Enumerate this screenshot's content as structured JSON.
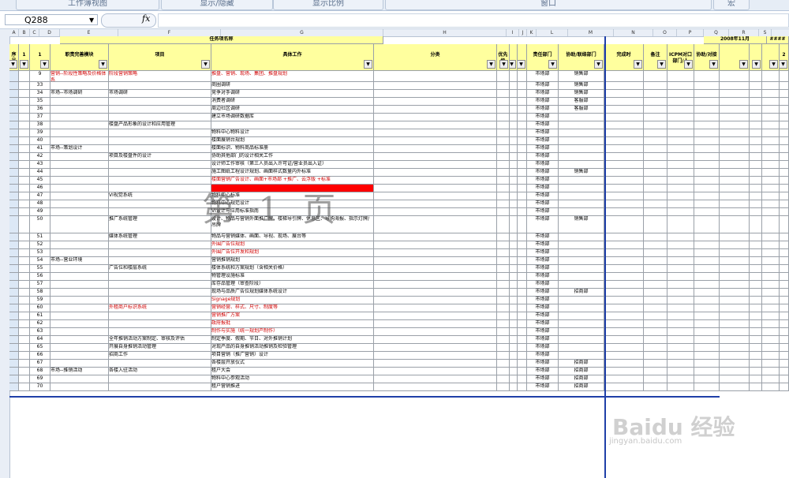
{
  "ribbon": {
    "tabs": [
      "工作簿视图",
      "显示/隐藏",
      "显示比例",
      "窗口",
      "宏"
    ]
  },
  "formula_bar": {
    "name_box": "Q288",
    "fx": "fx",
    "value": ""
  },
  "columns": [
    "A",
    "B",
    "C",
    "D",
    "E",
    "F",
    "G",
    "H",
    "I",
    "J",
    "K",
    "L",
    "M",
    "N",
    "O",
    "P",
    "Q",
    "R",
    "S"
  ],
  "header": {
    "group_title": "任务项名称",
    "date_label": "2008年11月",
    "hash": "####",
    "labels": {
      "a": "序号",
      "responsible": "职责完善模块",
      "item": "项目",
      "work": "具体工作",
      "category": "分类",
      "priority": "优先级",
      "dept": "责任部门",
      "assist": "协助/联络部门",
      "complete": "完成时",
      "note": "备注",
      "icpm": "ICPM对口部门/人",
      "assist2": "协助/对接",
      "c1": "1",
      "c2": "1",
      "c3": "2"
    }
  },
  "rows": [
    {
      "no": "9",
      "module": "营销--阶段性策略及价格体系",
      "item": "阶段营销策略",
      "work": "推盘、营销、现场、集团、推盘规划",
      "dept": "市场部",
      "assist": "销售部",
      "red": true
    },
    {
      "no": "33",
      "module": "",
      "item": "",
      "work": "商圈调研",
      "dept": "市场部",
      "assist": "销售部"
    },
    {
      "no": "34",
      "module": "市场--市场调研",
      "item": "市场调研",
      "work": "竞争对手调研",
      "dept": "市场部",
      "assist": "销售部"
    },
    {
      "no": "35",
      "module": "",
      "item": "",
      "work": "消费者调研",
      "dept": "市场部",
      "assist": "客服部"
    },
    {
      "no": "36",
      "module": "",
      "item": "",
      "work": "周边社区调研",
      "dept": "市场部",
      "assist": "客服部"
    },
    {
      "no": "37",
      "module": "",
      "item": "",
      "work": "建立市场调研数据库",
      "dept": "市场部",
      "assist": ""
    },
    {
      "no": "38",
      "module": "",
      "item": "楼盘产品形象的设计和应用管理",
      "work": "",
      "dept": "市场部",
      "assist": ""
    },
    {
      "no": "39",
      "module": "",
      "item": "",
      "work": "物料中心物料设计",
      "dept": "市场部",
      "assist": ""
    },
    {
      "no": "40",
      "module": "",
      "item": "",
      "work": "楼面展销台规划",
      "dept": "市场部",
      "assist": ""
    },
    {
      "no": "41",
      "module": "市场--策划设计",
      "item": "",
      "work": "楼面标识、物料商品标准册",
      "dept": "市场部",
      "assist": ""
    },
    {
      "no": "42",
      "module": "",
      "item": "项目及楼盘件的设计",
      "work": "协助其他部门的设计相关工作",
      "dept": "市场部",
      "assist": ""
    },
    {
      "no": "43",
      "module": "",
      "item": "",
      "work": "设计师工作审核（第三人员出入许可证/营业员出入证）",
      "dept": "市场部",
      "assist": ""
    },
    {
      "no": "44",
      "module": "",
      "item": "",
      "work": "施工图纸工程设计规划、画面样式数量内外标准",
      "dept": "市场部",
      "assist": "销售部"
    },
    {
      "no": "45",
      "module": "",
      "item": "",
      "work": "楼面营销广告设计、画面+市场部 +推广、云浮版 +标准",
      "dept": "市场部",
      "assist": "",
      "red": true
    },
    {
      "no": "46",
      "module": "",
      "item": "",
      "work": "",
      "dept": "市场部",
      "assist": "",
      "redfill": true
    },
    {
      "no": "47",
      "module": "",
      "item": "VI视觉系统",
      "work": "物料中心标准",
      "dept": "市场部",
      "assist": ""
    },
    {
      "no": "48",
      "module": "",
      "item": "",
      "work": "物料中心规范设计",
      "dept": "市场部",
      "assist": ""
    },
    {
      "no": "49",
      "module": "",
      "item": "",
      "work": "VI设计与应用标准指南",
      "dept": "市场部",
      "assist": ""
    },
    {
      "no": "50",
      "module": "",
      "item": "推广系统管理",
      "work": "设计、物品与营销外面推广牌、楼梯导引牌、休息区、导购海报、指示灯牌/吊牌",
      "dept": "市场部",
      "assist": "销售部"
    },
    {
      "no": "51",
      "module": "",
      "item": "媒体系统管理",
      "work": "物品与营销媒体、画面、导视、现场、展台等",
      "dept": "市场部",
      "assist": ""
    },
    {
      "no": "52",
      "module": "",
      "item": "",
      "work": "外围广告位规划",
      "dept": "市场部",
      "assist": "",
      "red": true
    },
    {
      "no": "53",
      "module": "",
      "item": "",
      "work": "外围广告位开发和规划",
      "dept": "市场部",
      "assist": "",
      "red": true
    },
    {
      "no": "54",
      "module": "市场--营业环境",
      "item": "",
      "work": "营销推销规划",
      "dept": "市场部",
      "assist": ""
    },
    {
      "no": "55",
      "module": "",
      "item": "广告位和楼层系统",
      "work": "楼体系统和方案规划（含相关价格）",
      "dept": "市场部",
      "assist": ""
    },
    {
      "no": "56",
      "module": "",
      "item": "",
      "work": "物管理设施标准",
      "dept": "市场部",
      "assist": ""
    },
    {
      "no": "57",
      "module": "",
      "item": "",
      "work": "库存品管理（审查阶段）",
      "dept": "市场部",
      "assist": ""
    },
    {
      "no": "58",
      "module": "",
      "item": "",
      "work": "现场与品质广告位规划媒体系统设计",
      "dept": "市场部",
      "assist": "招商部"
    },
    {
      "no": "59",
      "module": "",
      "item": "",
      "work": "Signage规划",
      "dept": "市场部",
      "assist": "",
      "red": true
    },
    {
      "no": "60",
      "module": "",
      "item": "外租商户标识系统",
      "work": "营销经营、样式、尺寸、制度等",
      "dept": "市场部",
      "assist": "",
      "red": true
    },
    {
      "no": "61",
      "module": "",
      "item": "",
      "work": "营销推广方案",
      "dept": "市场部",
      "assist": "",
      "red": true
    },
    {
      "no": "62",
      "module": "",
      "item": "",
      "work": "政府报批",
      "dept": "市场部",
      "assist": "",
      "red": true
    },
    {
      "no": "63",
      "module": "",
      "item": "",
      "work": "制作与实施（统一规划产制作）",
      "dept": "市场部",
      "assist": "",
      "red": true
    },
    {
      "no": "64",
      "module": "",
      "item": "全年推销活动方案制定、审核及评估",
      "work": "制定季度、假期、节日、对外推销计划",
      "dept": "市场部",
      "assist": ""
    },
    {
      "no": "65",
      "module": "",
      "item": "开展自身推销活动管理",
      "work": "对现产品的自身推销活动推销及检验管理",
      "dept": "市场部",
      "assist": ""
    },
    {
      "no": "66",
      "module": "",
      "item": "招商工作",
      "work": "项目营销（推广营销）设计",
      "dept": "市场部",
      "assist": ""
    },
    {
      "no": "67",
      "module": "",
      "item": "",
      "work": "各楼层开放仪式",
      "dept": "市场部",
      "assist": "招商部"
    },
    {
      "no": "68",
      "module": "市场--推销活动",
      "item": "各楼入驻活动",
      "work": "租户大会",
      "dept": "市场部",
      "assist": "招商部"
    },
    {
      "no": "69",
      "module": "",
      "item": "",
      "work": "物料中心参观活动",
      "dept": "市场部",
      "assist": "招商部"
    },
    {
      "no": "70",
      "module": "",
      "item": "",
      "work": "租户营销推进",
      "dept": "市场部",
      "assist": "招商部"
    }
  ],
  "watermark": "第 1 页",
  "logo": {
    "main": "Baidu 经验",
    "sub": "jingyan.baidu.com"
  }
}
